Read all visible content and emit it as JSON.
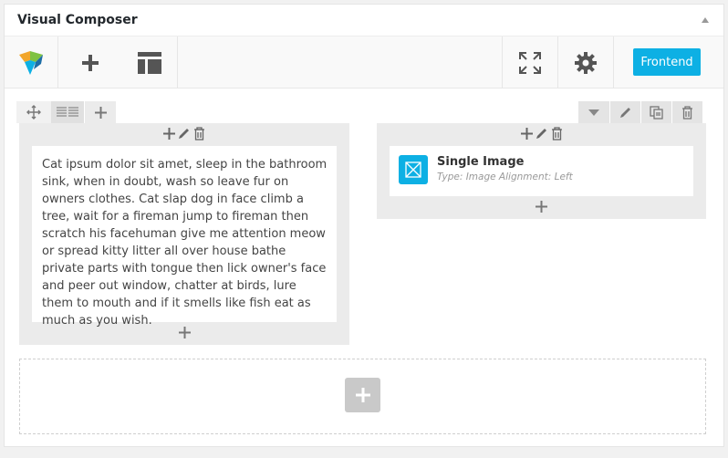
{
  "panel": {
    "title": "Visual Composer"
  },
  "toolbar": {
    "logo_icon": "vc-logo-icon",
    "add_element_icon": "plus-icon",
    "templates_icon": "layout-template-icon",
    "fullscreen_icon": "fullscreen-icon",
    "settings_icon": "gear-icon",
    "frontend_label": "Frontend"
  },
  "row": {
    "left_controls": [
      "move-icon",
      "column-layout-icon",
      "plus-icon"
    ],
    "right_controls": [
      "toggle-icon",
      "pencil-icon",
      "clone-icon",
      "trash-icon"
    ]
  },
  "columns": [
    {
      "element_type": "text_block",
      "text": "Cat ipsum dolor sit amet, sleep in the bathroom sink, when in doubt, wash so leave fur on owners clothes. Cat slap dog in face climb a tree, wait for a fireman jump to fireman then scratch his facehuman give me attention meow or spread kitty litter all over house bathe private parts with tongue then lick owner's face and peer out window, chatter at birds, lure them to mouth and if it smells like fish eat as much as you wish."
    },
    {
      "element_type": "single_image",
      "title": "Single Image",
      "meta": "Type: Image  Alignment: Left"
    }
  ],
  "colors": {
    "accent": "#0db0e4",
    "icon_gray": "#555555",
    "column_bg": "#ebebeb"
  }
}
